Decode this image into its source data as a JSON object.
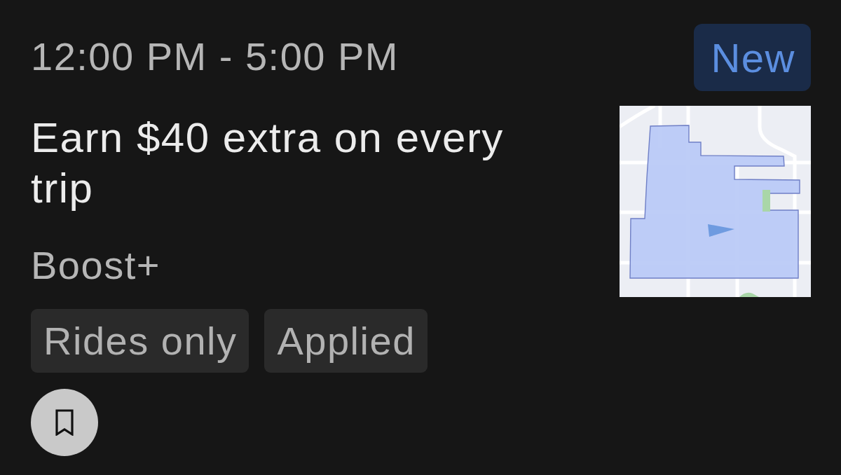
{
  "offer": {
    "time_range": "12:00 PM - 5:00 PM",
    "title": "Earn $40 extra on every trip",
    "category": "Boost+",
    "badge": "New",
    "tags": [
      "Rides only",
      "Applied"
    ]
  }
}
